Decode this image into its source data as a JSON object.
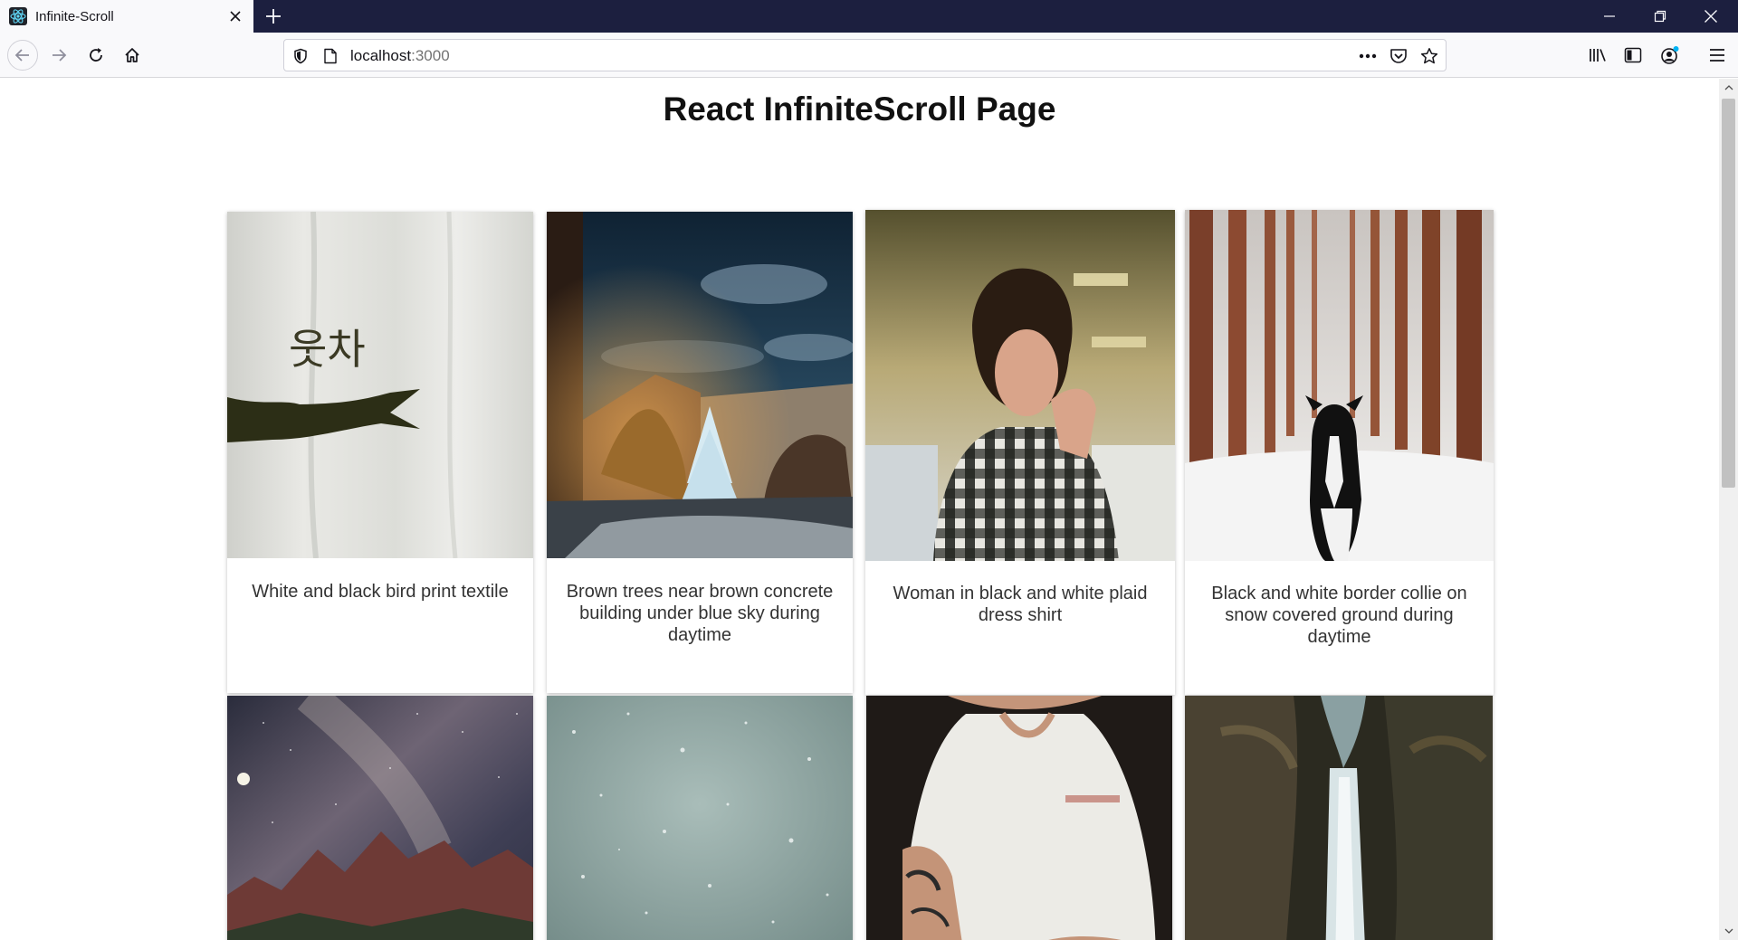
{
  "browser": {
    "tab_title": "Infinite-Scroll",
    "url_host": "localhost",
    "url_port": ":3000"
  },
  "page": {
    "title": "React InfiniteScroll Page",
    "cards": [
      {
        "caption": "White and black bird print textile"
      },
      {
        "caption": "Brown trees near brown concrete building under blue sky during daytime"
      },
      {
        "caption": "Woman in black and white plaid dress shirt"
      },
      {
        "caption": "Black and white border collie on snow covered ground during daytime"
      },
      {
        "caption": ""
      },
      {
        "caption": ""
      },
      {
        "caption": ""
      },
      {
        "caption": ""
      }
    ]
  },
  "icons": {
    "favicon": "react-atom-icon",
    "back": "arrow-left-icon",
    "forward": "arrow-right-icon",
    "reload": "reload-icon",
    "home": "home-icon",
    "shield": "shield-icon",
    "page": "page-icon",
    "more": "more-horizontal-icon",
    "pocket": "pocket-icon",
    "bookmark": "star-icon",
    "library": "library-icon",
    "sidebar": "sidebar-icon",
    "account": "account-icon",
    "menu": "hamburger-menu-icon"
  },
  "colors": {
    "tabstrip_bg": "#1c1f3f",
    "toolbar_bg": "#f9f9fb",
    "account_dot": "#00b3f4"
  }
}
